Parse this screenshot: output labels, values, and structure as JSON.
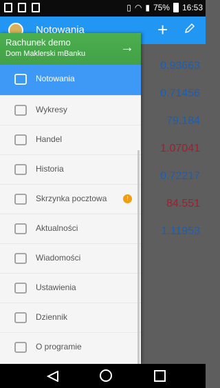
{
  "status_bar": {
    "battery": "75%",
    "time": "16:53"
  },
  "app_bar": {
    "title": "Notowania"
  },
  "background_quotes": [
    {
      "value": "0.93663",
      "color": "#1a5fb4"
    },
    {
      "value": "0.71456",
      "color": "#1a5fb4"
    },
    {
      "value": "79.184",
      "color": "#1a5fb4"
    },
    {
      "value": "1.07041",
      "color": "#a51d2d"
    },
    {
      "value": "0.72217",
      "color": "#1a5fb4"
    },
    {
      "value": "84.551",
      "color": "#a51d2d"
    },
    {
      "value": "1.11953",
      "color": "#1a5fb4"
    }
  ],
  "drawer": {
    "account": {
      "name": "Rachunek demo",
      "broker": "Dom Maklerski mBanku",
      "arrow": "→"
    },
    "items": [
      {
        "label": "Notowania",
        "icon": "chart-arrow-icon",
        "active": true
      },
      {
        "label": "Wykresy",
        "icon": "candlestick-icon"
      },
      {
        "label": "Handel",
        "icon": "trade-arrow-icon"
      },
      {
        "label": "Historia",
        "icon": "inbox-tray-icon"
      },
      {
        "label": "Skrzynka pocztowa",
        "icon": "envelope-icon",
        "badge": "!"
      },
      {
        "label": "Aktualności",
        "icon": "news-icon"
      },
      {
        "label": "Wiadomości",
        "icon": "chat-bubble-icon"
      },
      {
        "label": "Ustawienia",
        "icon": "gear-icon"
      },
      {
        "label": "Dziennik",
        "icon": "list-lines-icon"
      },
      {
        "label": "O programie",
        "icon": "info-icon"
      }
    ]
  },
  "colors": {
    "accent": "#2196f3",
    "active": "#3d99f5",
    "account_bg": "#4caf50",
    "badge": "#f39c12"
  }
}
